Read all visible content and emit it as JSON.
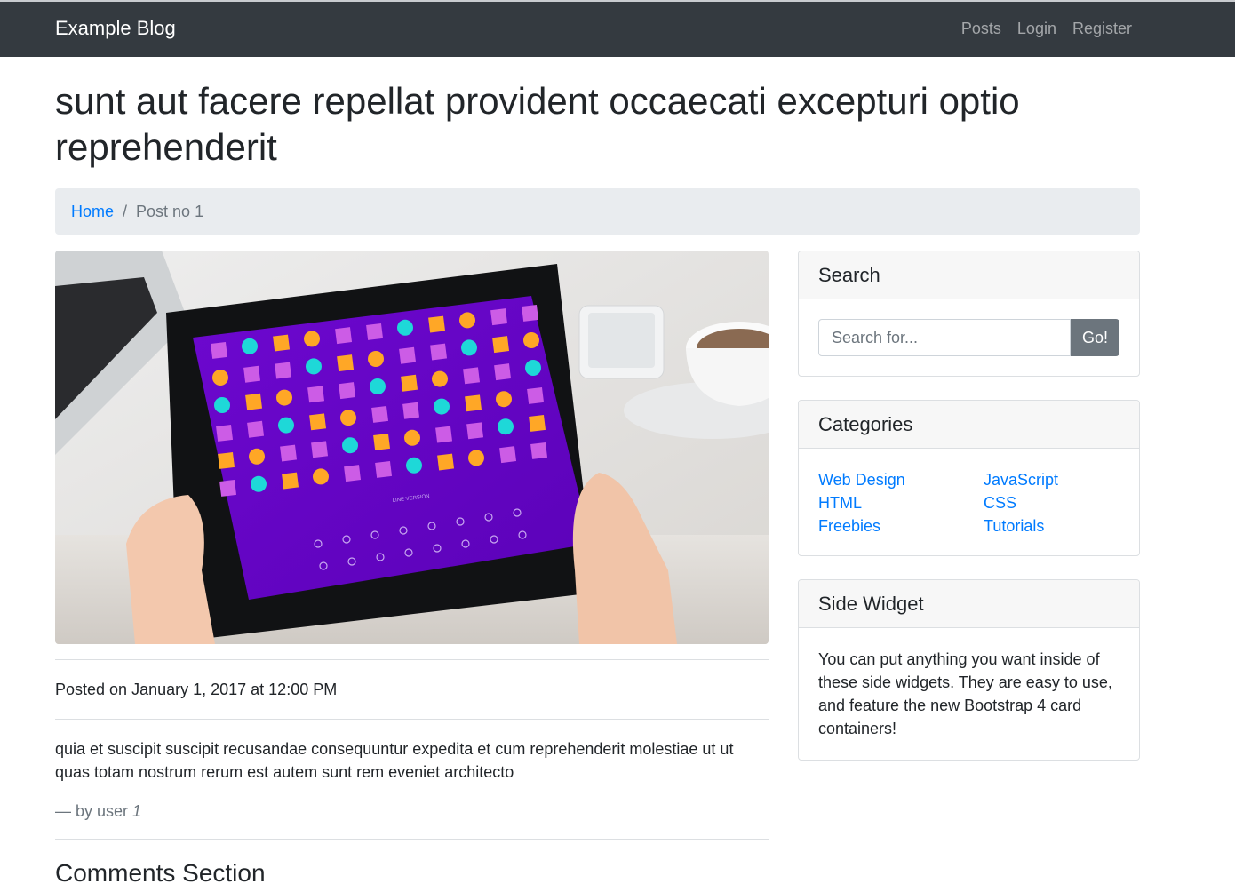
{
  "navbar": {
    "brand": "Example Blog",
    "links": [
      "Posts",
      "Login",
      "Register"
    ]
  },
  "post": {
    "title": "sunt aut facere repellat provident occaecati excepturi optio reprehenderit",
    "posted": "Posted on January 1, 2017 at 12:00 PM",
    "body": "quia et suscipit suscipit recusandae consequuntur expedita et cum reprehenderit molestiae ut ut quas totam nostrum rerum est autem sunt rem eveniet architecto",
    "byline_prefix": "— by user ",
    "user_id": "1",
    "image_caption": "LINE VERSION"
  },
  "breadcrumb": {
    "home": "Home",
    "current": "Post no 1"
  },
  "comments": {
    "title": "Comments Section"
  },
  "sidebar": {
    "search": {
      "title": "Search",
      "placeholder": "Search for...",
      "button": "Go!"
    },
    "categories": {
      "title": "Categories",
      "items": [
        "Web Design",
        "JavaScript",
        "HTML",
        "CSS",
        "Freebies",
        "Tutorials"
      ]
    },
    "widget": {
      "title": "Side Widget",
      "text": "You can put anything you want inside of these side widgets. They are easy to use, and feature the new Bootstrap 4 card containers!"
    }
  },
  "colors": {
    "navbar_bg": "#343a40",
    "link": "#007bff",
    "button_secondary": "#6c757d",
    "tablet_screen": "#6a06c8",
    "shape_orange": "#ffa726",
    "shape_cyan": "#1ed8d8",
    "shape_pink": "#cc5ce6"
  }
}
